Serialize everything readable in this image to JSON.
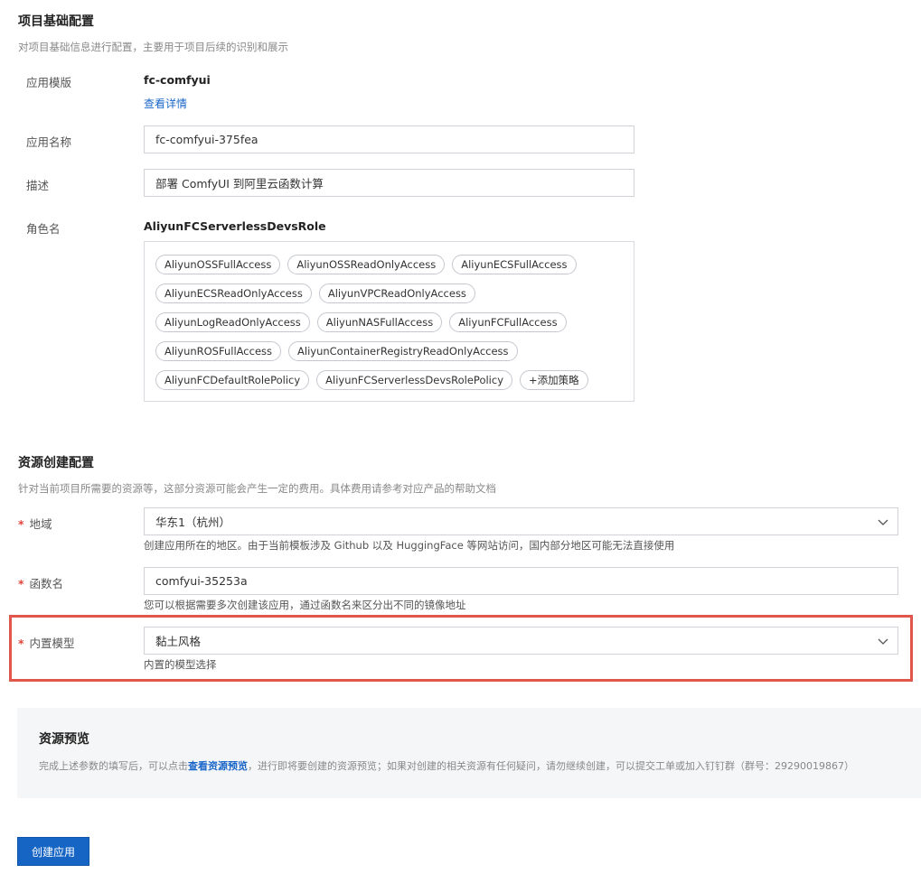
{
  "basic": {
    "title": "项目基础配置",
    "desc": "对项目基础信息进行配置，主要用于项目后续的识别和展示",
    "template_label": "应用模版",
    "template_value": "fc-comfyui",
    "template_link": "查看详情",
    "app_name_label": "应用名称",
    "app_name_value": "fc-comfyui-375fea",
    "desc_label": "描述",
    "desc_value": "部署 ComfyUI 到阿里云函数计算",
    "role_label": "角色名",
    "role_value": "AliyunFCServerlessDevsRole",
    "policies": [
      "AliyunOSSFullAccess",
      "AliyunOSSReadOnlyAccess",
      "AliyunECSFullAccess",
      "AliyunECSReadOnlyAccess",
      "AliyunVPCReadOnlyAccess",
      "AliyunLogReadOnlyAccess",
      "AliyunNASFullAccess",
      "AliyunFCFullAccess",
      "AliyunROSFullAccess",
      "AliyunContainerRegistryReadOnlyAccess",
      "AliyunFCDefaultRolePolicy",
      "AliyunFCServerlessDevsRolePolicy"
    ],
    "add_policy": "+添加策略"
  },
  "resource": {
    "title": "资源创建配置",
    "desc": "针对当前项目所需要的资源等，这部分资源可能会产生一定的费用。具体费用请参考对应产品的帮助文档",
    "required_mark": "*",
    "region_label": "地域",
    "region_value": "华东1（杭州）",
    "region_help": "创建应用所在的地区。由于当前模板涉及 Github 以及 HuggingFace 等网站访问，国内部分地区可能无法直接使用",
    "func_label": "函数名",
    "func_value": "comfyui-35253a",
    "func_help": "您可以根据需要多次创建该应用，通过函数名来区分出不同的镜像地址",
    "model_label": "内置模型",
    "model_value": "黏土风格",
    "model_help": "内置的模型选择"
  },
  "preview": {
    "title": "资源预览",
    "text_before": "完成上述参数的填写后，可以点击",
    "link": "查看资源预览",
    "text_after": "，进行即将要创建的资源预览；如果对创建的相关资源有任何疑问，请勿继续创建，可以提交工单或加入钉钉群（群号：29290019867）"
  },
  "actions": {
    "create": "创建应用"
  },
  "colors": {
    "accent": "#1665c4",
    "highlight": "#e0564a",
    "required": "#e0453a"
  }
}
